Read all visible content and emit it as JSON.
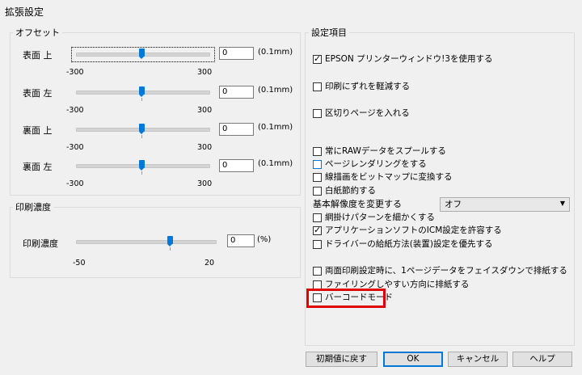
{
  "window": {
    "title": "拡張設定"
  },
  "offset": {
    "title": "オフセット",
    "unit": "(0.1mm)",
    "rows": [
      {
        "label": "表面 上",
        "value": "0",
        "min": "-300",
        "max": "300"
      },
      {
        "label": "表面 左",
        "value": "0",
        "min": "-300",
        "max": "300"
      },
      {
        "label": "裏面 上",
        "value": "0",
        "min": "-300",
        "max": "300"
      },
      {
        "label": "裏面 左",
        "value": "0",
        "min": "-300",
        "max": "300"
      }
    ]
  },
  "density": {
    "title": "印刷濃度",
    "label": "印刷濃度",
    "value": "0",
    "unit": "(%)",
    "min": "-50",
    "max": "20"
  },
  "settings": {
    "title": "設定項目",
    "top_items": [
      {
        "label": "EPSON プリンターウィンドウ!3を使用する",
        "checked": true
      },
      {
        "label": "印刷にずれを軽減する",
        "checked": false
      },
      {
        "label": "区切りページを入れる",
        "checked": false
      }
    ],
    "items": [
      {
        "label": "常にRAWデータをスプールする",
        "checked": false
      },
      {
        "label": "ページレンダリングをする",
        "checked": false
      },
      {
        "label": "線描画をビットマップに変換する",
        "checked": false
      },
      {
        "label": "白紙節約する",
        "checked": false
      }
    ],
    "resolution": {
      "label": "基本解像度を変更する",
      "value": "オフ"
    },
    "items2": [
      {
        "label": "網掛けパターンを細かくする",
        "checked": false
      },
      {
        "label": "アプリケーションソフトのICM設定を許容する",
        "checked": true
      },
      {
        "label": "ドライバーの給紙方法(装置)設定を優先する",
        "checked": false
      }
    ],
    "items3": [
      {
        "label": "両面印刷設定時に、1ページデータをフェイスダウンで排紙する",
        "checked": false
      },
      {
        "label": "ファイリングしやすい方向に排紙する",
        "checked": false
      }
    ],
    "barcode": {
      "label": "バーコードモード",
      "checked": false
    }
  },
  "buttons": {
    "reset": "初期値に戻す",
    "ok": "OK",
    "cancel": "キャンセル",
    "help": "ヘルプ"
  },
  "colors": {
    "accent": "#0078d7",
    "highlight": "#e00000"
  }
}
